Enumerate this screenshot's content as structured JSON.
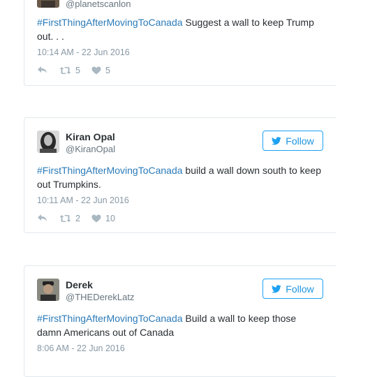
{
  "tweets": [
    {
      "handle": "@planetscanlon",
      "hashtag": "#FirstThingAfterMovingToCanada",
      "text": " Suggest a wall to keep Trump out. . .",
      "date": "10:14 AM - 22 Jun 2016",
      "retweets": "5",
      "likes": "5"
    },
    {
      "name": "Kiran Opal",
      "handle": "@KiranOpal",
      "hashtag": "#FirstThingAfterMovingToCanada",
      "text": " build a wall down south to keep out Trumpkins.",
      "date": "10:11 AM - 22 Jun 2016",
      "retweets": "2",
      "likes": "10",
      "follow_label": "Follow"
    },
    {
      "name": "Derek",
      "handle": "@THEDerekLatz",
      "hashtag": "#FirstThingAfterMovingToCanada",
      "text": " Build a wall to keep those damn Americans out of Canada",
      "date": "8:06 AM - 22 Jun 2016",
      "follow_label": "Follow"
    }
  ],
  "colors": {
    "link": "#2b7bb9",
    "follow_blue": "#1da1f2",
    "meta_gray": "#8899a6",
    "border": "#e1e8ed"
  }
}
